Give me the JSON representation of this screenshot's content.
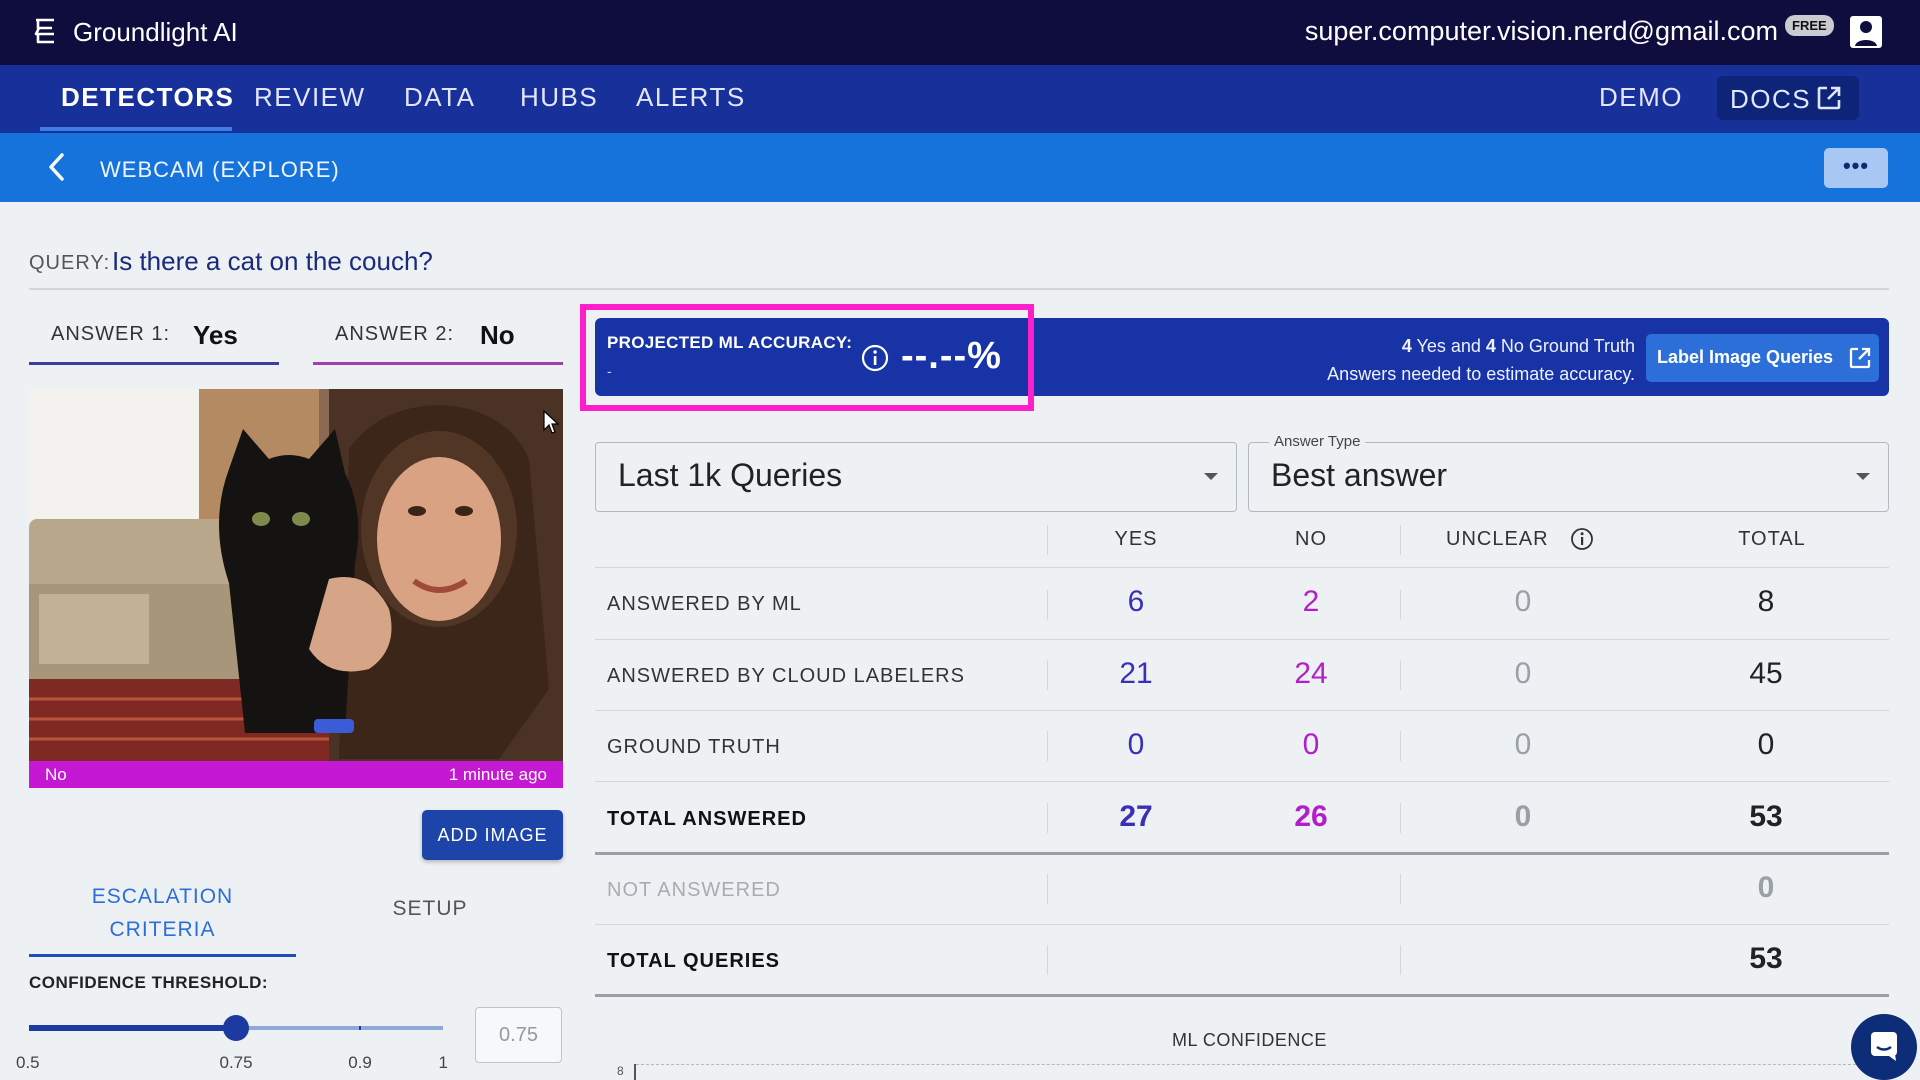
{
  "app": {
    "brand": "Groundlight AI",
    "user_email": "super.computer.vision.nerd@gmail.com",
    "plan_badge": "FREE"
  },
  "nav": {
    "items": [
      "DETECTORS",
      "REVIEW",
      "DATA",
      "HUBS",
      "ALERTS"
    ],
    "active": "DETECTORS",
    "demo": "DEMO",
    "docs": "DOCS"
  },
  "breadcrumb": {
    "title": "WEBCAM (EXPLORE)",
    "more": "•••"
  },
  "query": {
    "label": "QUERY:",
    "text": "Is there a cat on the couch?"
  },
  "answers": {
    "a1_label": "ANSWER 1:",
    "a1_value": "Yes",
    "a2_label": "ANSWER 2:",
    "a2_value": "No"
  },
  "image": {
    "label": "No",
    "time": "1 minute ago"
  },
  "add_image": "ADD IMAGE",
  "tabs": {
    "escalation_line1": "ESCALATION",
    "escalation_line2": "CRITERIA",
    "setup": "SETUP"
  },
  "confidence": {
    "label": "CONFIDENCE THRESHOLD:",
    "value": 0.75,
    "input_value": "0.75",
    "min_label": "0.5",
    "mark1_label": "0.75",
    "mark2_label": "0.9",
    "max_label": "1"
  },
  "accuracy": {
    "label": "PROJECTED ML ACCURACY:",
    "sub": "-",
    "value": "--.--%",
    "note_yes_count": "4",
    "note_yes_text": " Yes and ",
    "note_no_count": "4",
    "note_no_text": " No Ground Truth",
    "note_line2": "Answers needed to estimate accuracy.",
    "button": "Label Image Queries"
  },
  "filters": {
    "range": "Last 1k Queries",
    "answer_type_legend": "Answer Type",
    "answer_type": "Best answer"
  },
  "table": {
    "headers": {
      "yes": "YES",
      "no": "NO",
      "unclear": "UNCLEAR",
      "total": "TOTAL"
    },
    "rows": [
      {
        "label": "ANSWERED BY ML",
        "yes": "6",
        "no": "2",
        "unclear": "0",
        "total": "8"
      },
      {
        "label": "ANSWERED BY CLOUD LABELERS",
        "yes": "21",
        "no": "24",
        "unclear": "0",
        "total": "45"
      },
      {
        "label": "GROUND TRUTH",
        "yes": "0",
        "no": "0",
        "unclear": "0",
        "total": "0"
      },
      {
        "label": "TOTAL ANSWERED",
        "yes": "27",
        "no": "26",
        "unclear": "0",
        "total": "53"
      },
      {
        "label": "NOT ANSWERED",
        "total": "0"
      },
      {
        "label": "TOTAL QUERIES",
        "total": "53"
      }
    ]
  },
  "ml_confidence": {
    "title": "ML CONFIDENCE",
    "y_top": "8"
  },
  "colors": {
    "topbar": "#0e0d3e",
    "nav": "#17309a",
    "crumb": "#1573db",
    "yes": "#3b30b5",
    "no": "#b21ec9",
    "highlight": "#ff1ecb"
  }
}
